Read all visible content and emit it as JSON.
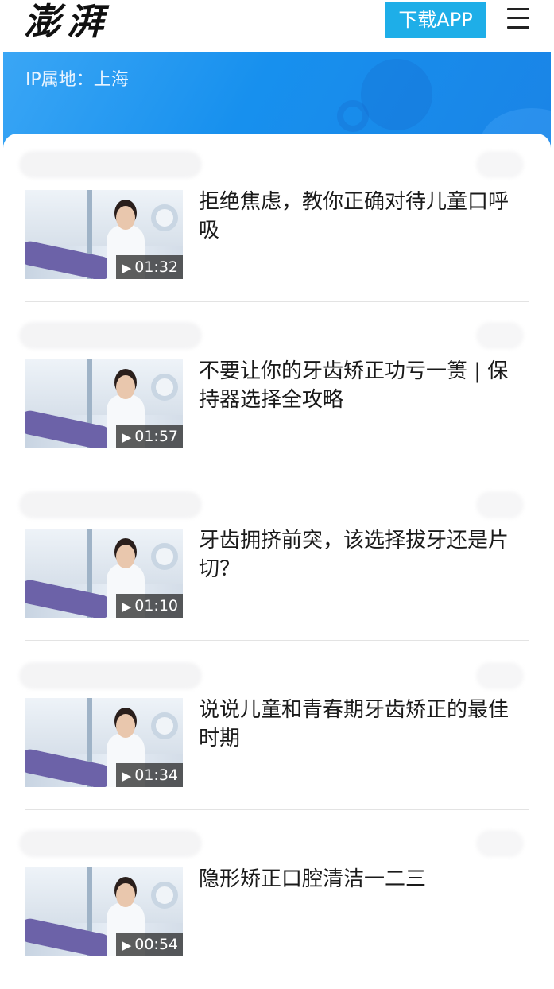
{
  "header": {
    "logo": "澎湃",
    "download_label": "下载APP",
    "menu_icon": "hamburger-menu-icon"
  },
  "banner": {
    "ip_location": "IP属地：上海",
    "color": "#1a8cf0"
  },
  "videos": [
    {
      "title": "拒绝焦虑，教你正确对待儿童口呼吸",
      "duration": "01:32"
    },
    {
      "title": "不要让你的牙齿矫正功亏一篑 | 保持器选择全攻略",
      "duration": "01:57"
    },
    {
      "title": "牙齿拥挤前突，该选择拔牙还是片切？",
      "duration": "01:10"
    },
    {
      "title": "说说儿童和青春期牙齿矫正的最佳时期",
      "duration": "01:34"
    },
    {
      "title": "隐形矫正口腔清洁一二三",
      "duration": "00:54"
    }
  ],
  "colors": {
    "accent": "#1eaee8",
    "divider": "#e3e3e3"
  }
}
